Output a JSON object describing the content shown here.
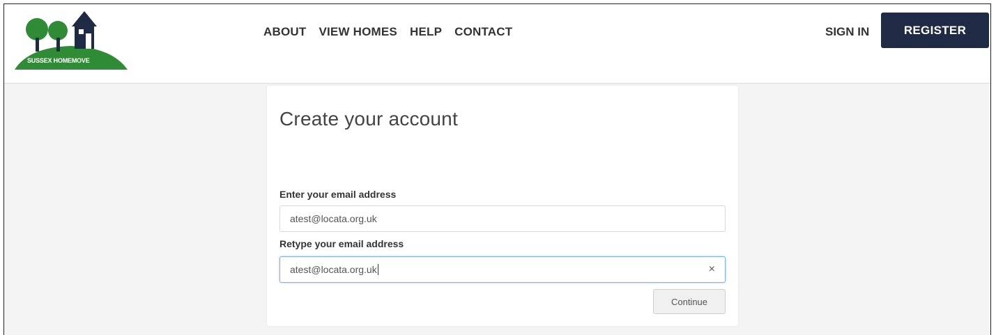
{
  "brand": {
    "logo_text": "SUSSEX HOMEMOVE",
    "colors": {
      "green": "#2f8b35",
      "navy": "#1f2a44"
    }
  },
  "nav": {
    "items": [
      {
        "label": "ABOUT"
      },
      {
        "label": "VIEW HOMES"
      },
      {
        "label": "HELP"
      },
      {
        "label": "CONTACT"
      }
    ],
    "sign_in": "SIGN IN",
    "register": "REGISTER"
  },
  "form": {
    "title": "Create your account",
    "email_label": "Enter your email address",
    "email_value": "atest@locata.org.uk",
    "retype_label": "Retype your email address",
    "retype_value": "atest@locata.org.uk",
    "clear_icon": "×",
    "continue_label": "Continue"
  }
}
